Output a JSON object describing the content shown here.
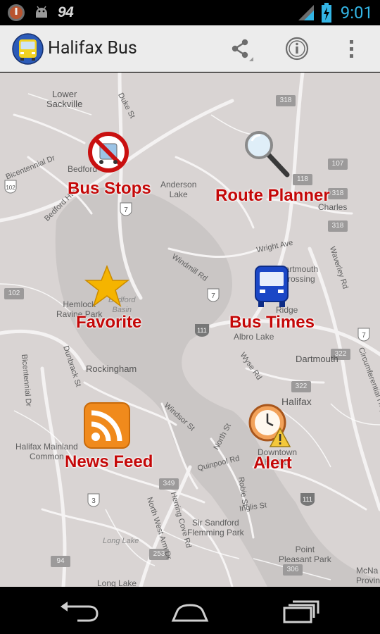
{
  "status_bar": {
    "notification_count": "94",
    "time": "9:01",
    "time_color": "#33b5e5"
  },
  "action_bar": {
    "title": "Halifax Bus",
    "icons": [
      "bus-app-icon",
      "share-icon",
      "info-icon",
      "overflow-menu-icon"
    ]
  },
  "map": {
    "place_labels": [
      "Lower\nSackville",
      "Bedford",
      "Anderson\nLake",
      "Hemlock\nRavine Park",
      "Bedford\nBasin",
      "Dartmouth\nCrossing",
      "Albro Lake",
      "Dartmouth",
      "Rockingham",
      "Halifax Mainland\nCommon",
      "Halifax",
      "Downtown\nHalifax",
      "Sir Sandford\nFlemming Park",
      "Long Lake",
      "Point\nPleasant Park",
      "Long Lake",
      "McNa\nProvin",
      "Ridge",
      "Charles"
    ],
    "street_labels": [
      "Duke St",
      "Bicentennial Dr",
      "Bedford Hwy",
      "Windmill Rd",
      "Wright Ave",
      "Waverley Rd",
      "Wyse Rd",
      "Circumferential Hwy",
      "Bicentennial Dr",
      "Dunbrack St",
      "Windsor St",
      "North St",
      "Quinpool Rd",
      "Robie St",
      "Inglis St",
      "Herring Cove Rd",
      "North West Arm Dr"
    ],
    "route_badges": [
      "318",
      "107",
      "118",
      "318",
      "318",
      "102",
      "322",
      "322",
      "349",
      "253",
      "306",
      "94"
    ],
    "highway_shields": [
      "7",
      "7",
      "7",
      "111",
      "111",
      "3",
      "102"
    ]
  },
  "menu": {
    "bus_stops": "Bus Stops",
    "route_planner": "Route Planner",
    "favorite": "Favorite",
    "bus_times": "Bus Times",
    "news_feed": "News Feed",
    "alert": "Alert",
    "label_color": "#c40808"
  },
  "nav_bar": {
    "icons": [
      "back-icon",
      "home-icon",
      "recent-apps-icon"
    ]
  }
}
